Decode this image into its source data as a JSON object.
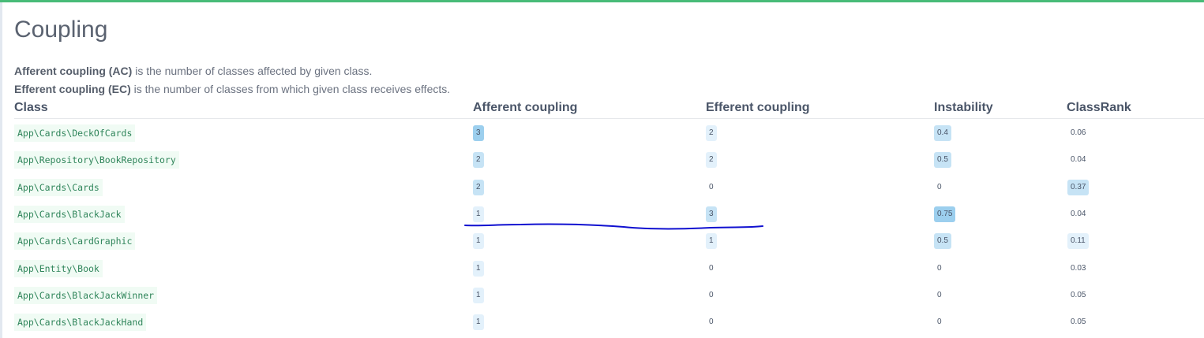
{
  "page": {
    "title": "Coupling",
    "desc_ac_term": "Afferent coupling (AC)",
    "desc_ac_text": " is the number of classes affected by given class.",
    "desc_ec_term": "Efferent coupling (EC)",
    "desc_ec_text": " is the number of classes from which given class receives effects."
  },
  "colors": {
    "accent": "#48bb78",
    "class_text": "#2f855a",
    "scribble": "#1010d0"
  },
  "table": {
    "headers": {
      "class": "Class",
      "afferent": "Afferent coupling",
      "efferent": "Efferent coupling",
      "instability": "Instability",
      "classrank": "ClassRank"
    },
    "rows": [
      {
        "class": "App\\Cards\\DeckOfCards",
        "afferent": "3",
        "efferent": "2",
        "instability": "0.4",
        "classrank": "0.06"
      },
      {
        "class": "App\\Repository\\BookRepository",
        "afferent": "2",
        "efferent": "2",
        "instability": "0.5",
        "classrank": "0.04"
      },
      {
        "class": "App\\Cards\\Cards",
        "afferent": "2",
        "efferent": "0",
        "instability": "0",
        "classrank": "0.37"
      },
      {
        "class": "App\\Cards\\BlackJack",
        "afferent": "1",
        "efferent": "3",
        "instability": "0.75",
        "classrank": "0.04"
      },
      {
        "class": "App\\Cards\\CardGraphic",
        "afferent": "1",
        "efferent": "1",
        "instability": "0.5",
        "classrank": "0.11"
      },
      {
        "class": "App\\Entity\\Book",
        "afferent": "1",
        "efferent": "0",
        "instability": "0",
        "classrank": "0.03"
      },
      {
        "class": "App\\Cards\\BlackJackWinner",
        "afferent": "1",
        "efferent": "0",
        "instability": "0",
        "classrank": "0.05"
      },
      {
        "class": "App\\Cards\\BlackJackHand",
        "afferent": "1",
        "efferent": "0",
        "instability": "0",
        "classrank": "0.05"
      }
    ]
  }
}
